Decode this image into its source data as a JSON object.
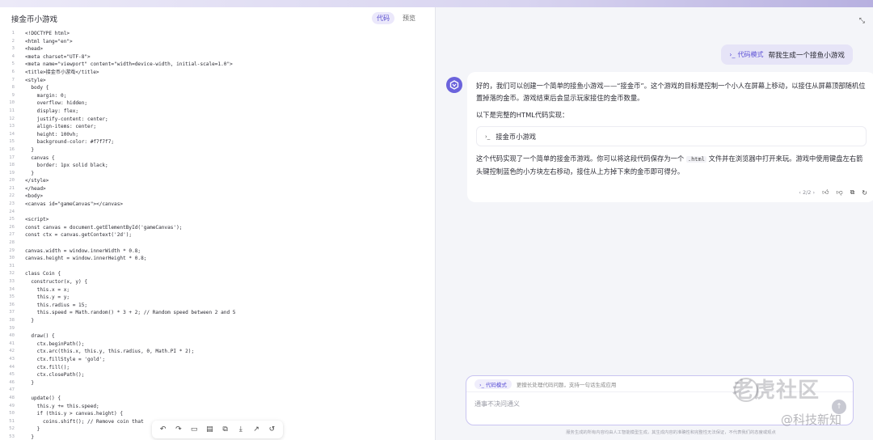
{
  "left_panel": {
    "title": "接金币小游戏",
    "tabs": [
      {
        "label": "代码",
        "active": true
      },
      {
        "label": "预览",
        "active": false
      }
    ],
    "code_lines": [
      "<!DOCTYPE html>",
      "<html lang=\"en\">",
      "<head>",
      "<meta charset=\"UTF-8\">",
      "<meta name=\"viewport\" content=\"width=device-width, initial-scale=1.0\">",
      "<title>接金币小游戏</title>",
      "<style>",
      "  body {",
      "    margin: 0;",
      "    overflow: hidden;",
      "    display: flex;",
      "    justify-content: center;",
      "    align-items: center;",
      "    height: 100vh;",
      "    background-color: #f7f7f7;",
      "  }",
      "  canvas {",
      "    border: 1px solid black;",
      "  }",
      "</style>",
      "</head>",
      "<body>",
      "<canvas id=\"gameCanvas\"></canvas>",
      "",
      "<script>",
      "const canvas = document.getElementById('gameCanvas');",
      "const ctx = canvas.getContext('2d');",
      "",
      "canvas.width = window.innerWidth * 0.8;",
      "canvas.height = window.innerHeight * 0.8;",
      "",
      "class Coin {",
      "  constructor(x, y) {",
      "    this.x = x;",
      "    this.y = y;",
      "    this.radius = 15;",
      "    this.speed = Math.random() * 3 + 2; // Random speed between 2 and 5",
      "  }",
      "",
      "  draw() {",
      "    ctx.beginPath();",
      "    ctx.arc(this.x, this.y, this.radius, 0, Math.PI * 2);",
      "    ctx.fillStyle = 'gold';",
      "    ctx.fill();",
      "    ctx.closePath();",
      "  }",
      "",
      "  update() {",
      "    this.y += this.speed;",
      "    if (this.y > canvas.height) {",
      "      coins.shift(); // Remove coin that",
      "    }",
      "  }"
    ]
  },
  "chat": {
    "user_mode_tag": "代码模式",
    "user_message": "帮我生成一个接鱼小游戏",
    "reply_p1": "好的，我们可以创建一个简单的接鱼小游戏——“接金币”。这个游戏的目标是控制一个小人在屏幕上移动，以接住从屏幕顶部随机位置掉落的金币。游戏结束后会显示玩家接住的金币数量。",
    "reply_p2": "以下是完整的HTML代码实现：",
    "code_card_icon": "›_",
    "code_card_label": "接金币小游戏",
    "reply_p3_before": "这个代码实现了一个简单的接金币游戏。你可以将这段代码保存为一个",
    "reply_p3_code": ".html",
    "reply_p3_after": "文件并在浏览器中打开来玩。游戏中使用键盘左右箭头键控制蓝色的小方块左右移动，接住从上方掉下来的金币即可得分。",
    "pager": "‹ 2/2 ›"
  },
  "input": {
    "mode_chip": "›_ 代码模式",
    "mode_hint": "更擅长处理代码问题，支持一句话生成应用",
    "placeholder": "通事不决问通义",
    "disclaimer": "服务生成的所有内容均由人工智能模型生成，其生成内容的准确性和完整性无法保证，不代表我们的态度或观点"
  },
  "watermark": {
    "main": "老虎社区",
    "sub": "@科技新知"
  },
  "colors": {
    "accent": "#5d52d6",
    "user_bubble": "#e6e4f7",
    "page_bg": "#f4f5f9"
  }
}
